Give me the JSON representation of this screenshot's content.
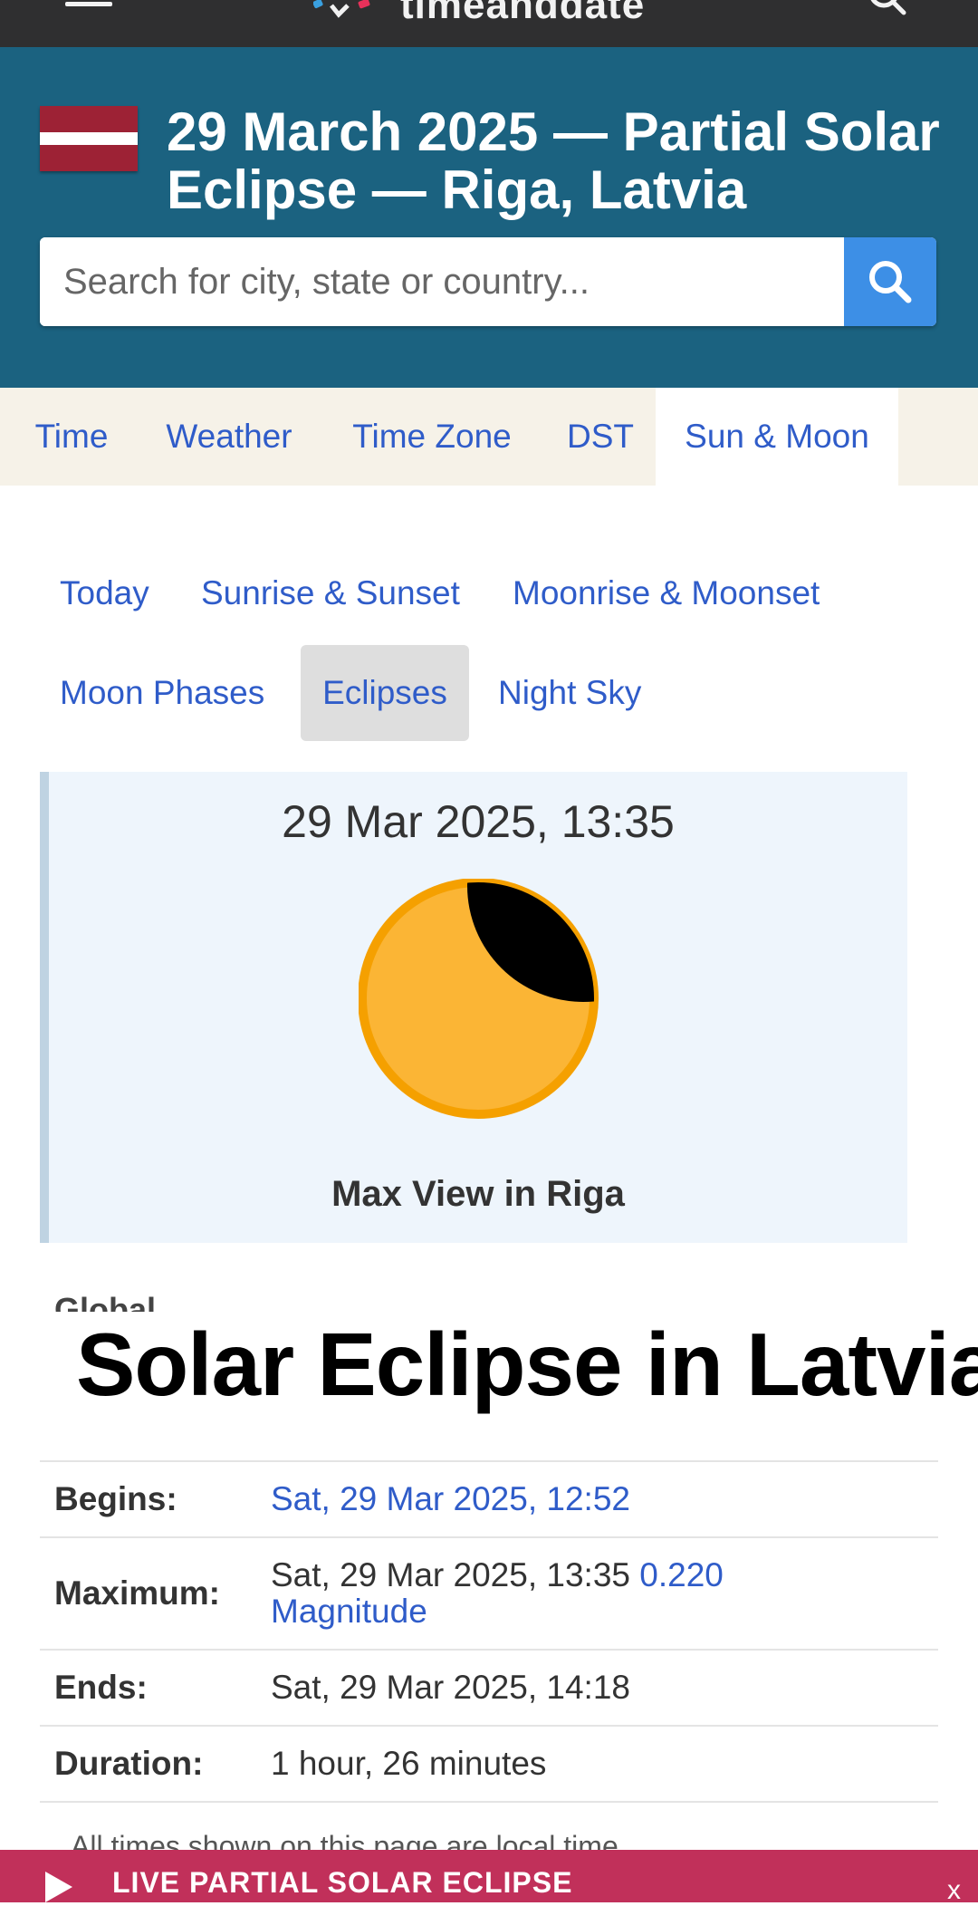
{
  "site": {
    "logo_text": "timeanddate"
  },
  "header": {
    "title": "29 March 2025 — Partial Solar Eclipse — Riga, Latvia",
    "search_placeholder": "Search for city, state or country..."
  },
  "main_tabs": [
    {
      "label": "Time",
      "active": false
    },
    {
      "label": "Weather",
      "active": false
    },
    {
      "label": "Time Zone",
      "active": false
    },
    {
      "label": "DST",
      "active": false
    },
    {
      "label": "Sun & Moon",
      "active": true
    }
  ],
  "subnav": [
    {
      "label": "Today",
      "active": false
    },
    {
      "label": "Sunrise & Sunset",
      "active": false
    },
    {
      "label": "Moonrise & Moonset",
      "active": false
    },
    {
      "label": "Moon Phases",
      "active": false
    },
    {
      "label": "Eclipses",
      "active": true
    },
    {
      "label": "Night Sky",
      "active": false
    }
  ],
  "eclipse_card": {
    "datetime": "29 Mar 2025, 13:35",
    "caption": "Max View in Riga",
    "sun_color": "#fbb535",
    "sun_ring_color": "#f5a000",
    "moon_color": "#000000"
  },
  "global_label": "Global",
  "overlay_title": "Solar Eclipse in Latvia",
  "eclipse_times": {
    "begins": {
      "label": "Begins:",
      "value": "Sat, 29 Mar 2025, 12:52"
    },
    "maximum": {
      "label": "Maximum:",
      "value": "Sat, 29 Mar 2025, 13:35",
      "magnitude": "0.220",
      "magnitude_label": "Magnitude"
    },
    "ends": {
      "label": "Ends:",
      "value": "Sat, 29 Mar 2025, 14:18"
    },
    "duration": {
      "label": "Duration:",
      "value": "1 hour, 26 minutes"
    }
  },
  "footnote": "All times shown on this page are local time.",
  "live_bar": {
    "text": "LIVE PARTIAL SOLAR ECLIPSE",
    "close_label": "x"
  },
  "colors": {
    "header_bg": "#1b6280",
    "tab_bar_bg": "#f6f2e8",
    "link": "#2f5cc9",
    "search_button": "#3d8fe6",
    "live_bar_bg": "#c1305a"
  }
}
